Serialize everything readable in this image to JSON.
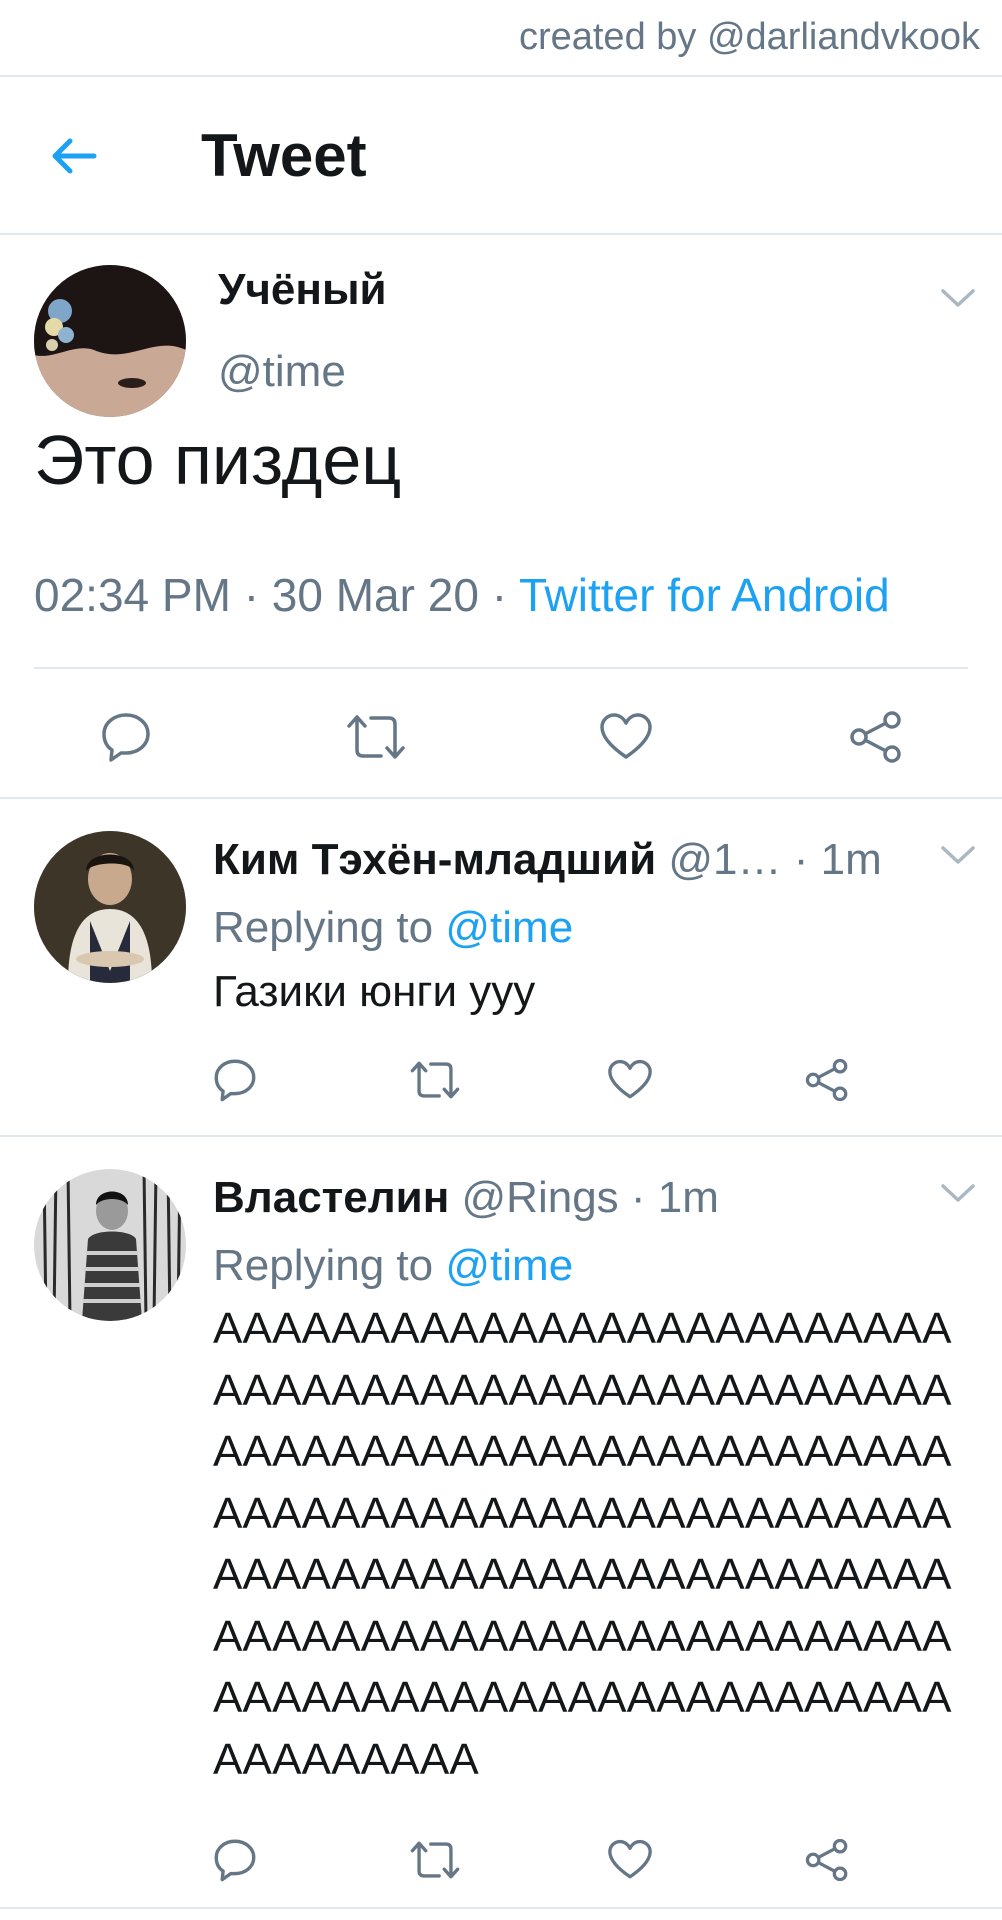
{
  "credit": "created by @darliandvkook",
  "header": {
    "title": "Tweet"
  },
  "main_tweet": {
    "name": "Учёный",
    "handle": "@time",
    "text": "Это пиздец",
    "time": "02:34 PM",
    "date": "30 Mar 20",
    "source": "Twitter for Android"
  },
  "replies": [
    {
      "name": "Ким Тэхён-младший",
      "handle": "@1…",
      "time": "1m",
      "replying_label": "Replying to",
      "replying_to": "@time",
      "text": "Газики юнги ууу"
    },
    {
      "name": "Властелин",
      "handle": "@Rings",
      "time": "1m",
      "replying_label": "Replying to",
      "replying_to": "@time",
      "text": "АААААААААААААААААААААААААААААААААААААААААААААААААААААААААААААААААААААААААААААААААААААААААААААААААААААААААААААААААААААААААААААААААААААААААААААААААААААААААААААААААААААААААААААААААААААААА"
    }
  ],
  "icons": {
    "back": "arrow-left-icon",
    "caret": "chevron-down-icon",
    "reply": "reply-icon",
    "retweet": "retweet-icon",
    "like": "heart-icon",
    "share": "share-icon"
  },
  "colors": {
    "accent": "#1da1f2",
    "secondary_text": "#657786",
    "divider": "#e1e8ed",
    "icon": "#657786"
  }
}
